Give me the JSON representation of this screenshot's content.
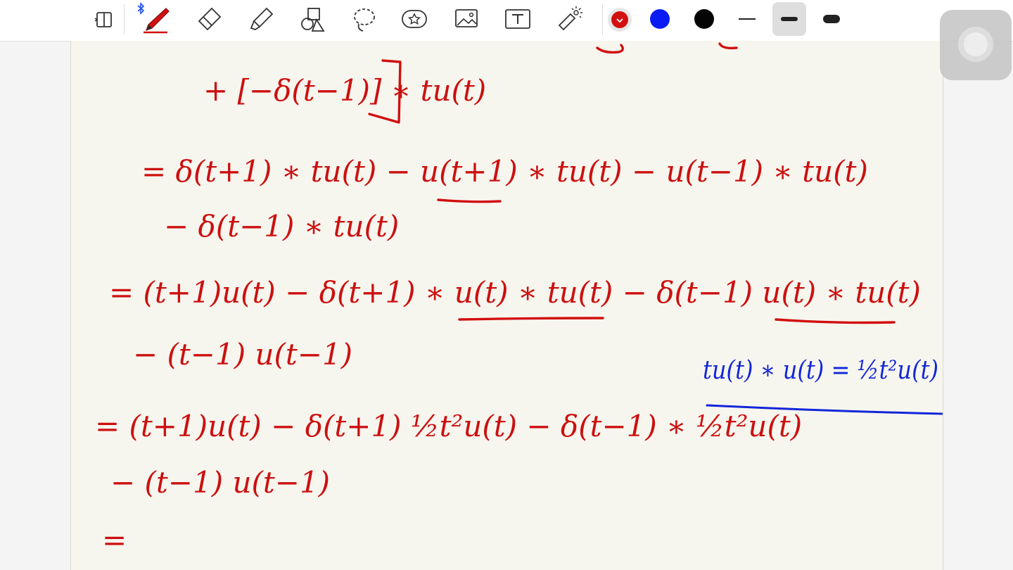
{
  "toolbar": {
    "tools": [
      {
        "icon": "page-layout-icon",
        "active": false
      },
      {
        "icon": "pen-icon",
        "active": true
      },
      {
        "icon": "eraser-icon",
        "active": false
      },
      {
        "icon": "highlighter-icon",
        "active": false
      },
      {
        "icon": "shapes-icon",
        "active": false
      },
      {
        "icon": "lasso-icon",
        "active": false
      },
      {
        "icon": "sticker-icon",
        "active": false
      },
      {
        "icon": "image-icon",
        "active": false
      },
      {
        "icon": "text-tool-icon",
        "active": false
      },
      {
        "icon": "laser-pointer-icon",
        "active": false
      }
    ],
    "bluetooth_icon": "bluetooth-icon",
    "colors": [
      {
        "name": "red",
        "hex": "#d10f0f",
        "selected": true
      },
      {
        "name": "blue",
        "hex": "#0a1cf2",
        "selected": false
      },
      {
        "name": "black",
        "hex": "#050505",
        "selected": false
      }
    ],
    "stroke_widths": [
      {
        "name": "thin",
        "selected": false
      },
      {
        "name": "medium",
        "selected": true
      },
      {
        "name": "thick",
        "selected": false
      }
    ]
  },
  "note": {
    "ink_colors": {
      "red": "#d10f0f",
      "blue": "#1226d8"
    },
    "lines": [
      "+ [−δ(t−1)] ∗ tu(t)",
      "= δ(t+1) ∗ tu(t) − u(t+1) ∗ tu(t) − u(t−1) ∗ tu(t)",
      "− δ(t−1) ∗ tu(t)",
      "= (t+1)u(t) − δ(t+1) ∗ u(t) ∗ tu(t) − δ(t−1) u(t) ∗ tu(t)",
      "− (t−1) u(t−1)",
      "= (t+1)u(t) − δ(t+1) ½t²u(t) − δ(t−1) ∗ ½t²u(t)",
      "− (t−1) u(t−1)",
      "="
    ],
    "side_note": "tu(t) ∗ u(t) = ½t²u(t)"
  },
  "assistive_touch": {
    "icon": "assistive-touch-icon"
  }
}
